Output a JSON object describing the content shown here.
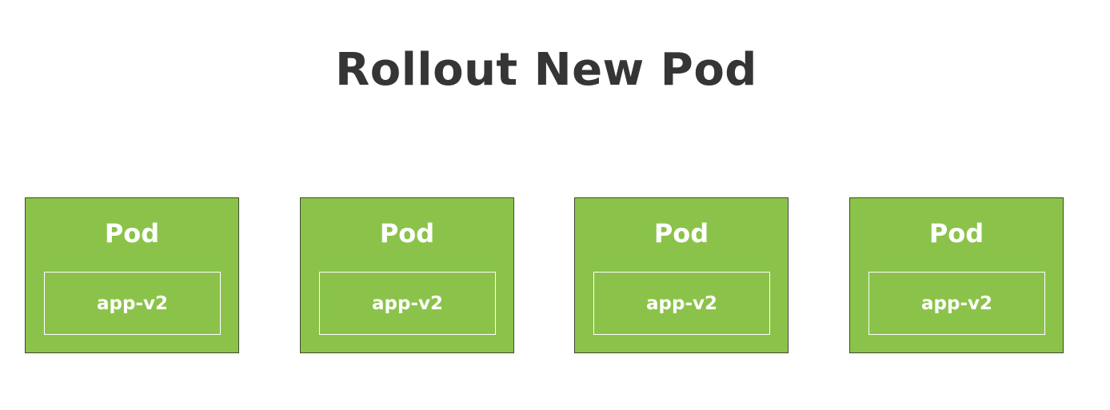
{
  "title": "Rollout New Pod",
  "pods": [
    {
      "label": "Pod",
      "container": "app-v2"
    },
    {
      "label": "Pod",
      "container": "app-v2"
    },
    {
      "label": "Pod",
      "container": "app-v2"
    },
    {
      "label": "Pod",
      "container": "app-v2"
    }
  ],
  "colors": {
    "pod_fill": "#8bc34a",
    "pod_border": "#3f4a34",
    "title_text": "#353535",
    "label_text": "#ffffff"
  }
}
